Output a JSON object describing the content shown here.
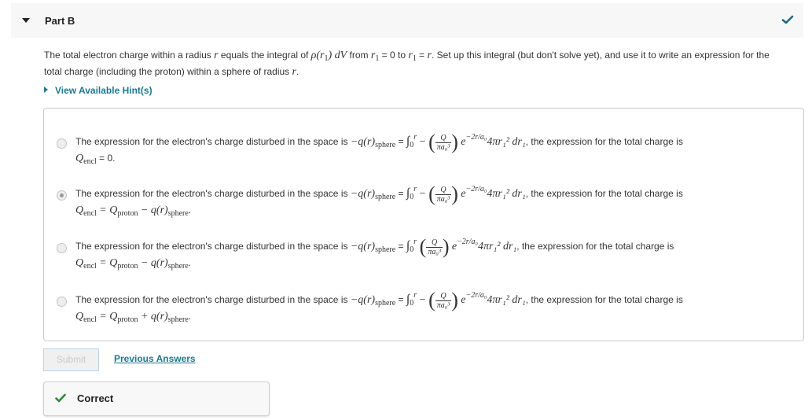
{
  "part": {
    "title": "Part B",
    "status_icon": "checkmark-icon",
    "accent_color": "#1b6b82"
  },
  "question": {
    "t1": "The total electron charge within a radius ",
    "v_r": "r",
    "t2": " equals  the integral of ",
    "v_rho": "ρ(r",
    "v_sub1": "1",
    "v_rho_end": ") dV",
    "t3": " from ",
    "v_r1a": "r",
    "v_sub1a": "1",
    "t4": " = 0 to ",
    "v_r1b": "r",
    "v_sub1b": "1",
    "t5": " = ",
    "v_r2": "r",
    "t6": ". Set up this integral (but don't solve yet), and use it to write an expression for the total charge (including the proton) within a sphere of radius ",
    "v_r3": "r",
    "t7": "."
  },
  "hint": {
    "label": "View Available Hint(s)"
  },
  "options": [
    {
      "selected": false,
      "prefix": "The expression for the electron's charge disturbed in the space is ",
      "lhs": "−q(r)",
      "lhs_sub": "sphere",
      "eq": " = ",
      "integral": "∫",
      "lower": "0",
      "upper": "r",
      "sign": " − ",
      "frac_num": "Q",
      "frac_den": "πa₀³",
      "exp_base": "e",
      "exp": "−2r/a₀",
      "rest": "4πr₁² dr₁",
      "suffix": ", the expression for the total charge is",
      "line2_q": "Q",
      "line2_sub": "encl",
      "line2_rest": " = 0."
    },
    {
      "selected": true,
      "prefix": "The expression for the electron's charge disturbed in the space is ",
      "lhs": "−q(r)",
      "lhs_sub": "sphere",
      "eq": " = ",
      "integral": "∫",
      "lower": "0",
      "upper": "r",
      "sign": " − ",
      "frac_num": "Q",
      "frac_den": "πa₀³",
      "exp_base": "e",
      "exp": "−2r/a₀",
      "rest": "4πr₁² dr₁",
      "suffix": ", the expression for the total charge is",
      "line2_q": "Q",
      "line2_sub": "encl",
      "line2_rest": " = Q",
      "line2_sub2": "proton",
      "line2_op": " − q(r)",
      "line2_sub3": "sphere",
      "line2_end": "."
    },
    {
      "selected": false,
      "prefix": "The expression for the electron's charge disturbed in the space is ",
      "lhs": "−q(r)",
      "lhs_sub": "sphere",
      "eq": " = ",
      "integral": "∫",
      "lower": "0",
      "upper": "r",
      "sign": " ",
      "frac_num": "Q",
      "frac_den": "πa₀³",
      "exp_base": "e",
      "exp": "−2r/a₀",
      "rest": "4πr₁² dr₁",
      "suffix": ", the expression for the total charge is",
      "line2_q": "Q",
      "line2_sub": "encl",
      "line2_rest": " = Q",
      "line2_sub2": "proton",
      "line2_op": " − q(r)",
      "line2_sub3": "sphere",
      "line2_end": "."
    },
    {
      "selected": false,
      "prefix": "The expression for the electron's charge disturbed in the space is ",
      "lhs": "−q(r)",
      "lhs_sub": "sphere",
      "eq": " = ",
      "integral": "∫",
      "lower": "0",
      "upper": "r",
      "sign": " − ",
      "frac_num": "Q",
      "frac_den": "πa₀³",
      "exp_base": "e",
      "exp": "−2r/a₀",
      "rest": "4πr₁² dr₁",
      "suffix": ", the expression for the total charge is",
      "line2_q": "Q",
      "line2_sub": "encl",
      "line2_rest": " = Q",
      "line2_sub2": "proton",
      "line2_op": " + q(r)",
      "line2_sub3": "sphere",
      "line2_end": "."
    }
  ],
  "actions": {
    "submit_label": "Submit",
    "previous_answers_label": "Previous Answers"
  },
  "feedback": {
    "label": "Correct",
    "icon": "checkmark-icon",
    "color": "#2e8b3a"
  }
}
